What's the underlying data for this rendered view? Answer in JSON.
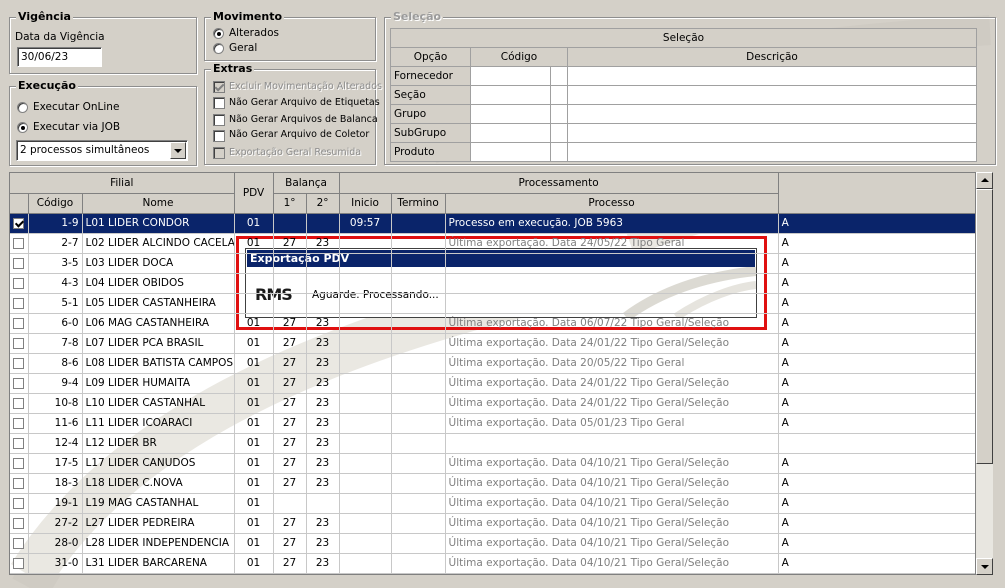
{
  "vigencia": {
    "title": "Vigência",
    "date_label": "Data da Vigência",
    "date_value": "30/06/23"
  },
  "movimento": {
    "title": "Movimento",
    "options": [
      "Alterados",
      "Geral"
    ],
    "selected": "Alterados"
  },
  "execucao": {
    "title": "Execução",
    "options": [
      "Executar OnLine",
      "Executar via JOB"
    ],
    "selected": "Executar via JOB",
    "combo_value": "2 processos simultâneos"
  },
  "extras": {
    "title": "Extras",
    "items": [
      {
        "label": "Excluir Movimentação Alterados",
        "checked": true,
        "disabled": true
      },
      {
        "label": "Não Gerar Arquivo de Etiquetas",
        "checked": false,
        "disabled": false
      },
      {
        "label": "Não Gerar Arquivos de Balanca",
        "checked": false,
        "disabled": false
      },
      {
        "label": "Não Gerar Arquivo de Coletor",
        "checked": false,
        "disabled": false
      },
      {
        "label": "Exportação Geral Resumida",
        "checked": false,
        "disabled": true
      }
    ]
  },
  "selecao": {
    "title": "Seleção",
    "header": "Seleção",
    "columns": [
      "Opção",
      "Código",
      "Descrição"
    ],
    "rows": [
      "Fornecedor",
      "Seção",
      "Grupo",
      "SubGrupo",
      "Produto"
    ]
  },
  "grid": {
    "groups": {
      "filial": "Filial",
      "pdv": "PDV",
      "balanca": "Balança",
      "processamento": "Processamento"
    },
    "columns": {
      "codigo": "Código",
      "nome": "Nome",
      "b1": "1°",
      "b2": "2°",
      "inicio": "Inicio",
      "termino": "Termino",
      "processo": "Processo"
    },
    "rows": [
      {
        "checked": true,
        "codigo": "1-9",
        "nome": "L01 LIDER CONDOR",
        "pdv": "01",
        "b1": "",
        "b2": "",
        "inicio": "09:57",
        "termino": "",
        "processo": "Processo em execução. JOB 5963",
        "extra": "A",
        "selected": true
      },
      {
        "checked": false,
        "codigo": "2-7",
        "nome": "L02 LIDER ALCINDO CACELA",
        "pdv": "01",
        "b1": "27",
        "b2": "23",
        "inicio": "",
        "termino": "",
        "processo": "Última exportação. Data 24/05/22 Tipo Geral",
        "extra": "A"
      },
      {
        "checked": false,
        "codigo": "3-5",
        "nome": "L03 LIDER DOCA",
        "pdv": "",
        "b1": "",
        "b2": "",
        "inicio": "",
        "termino": "",
        "processo": "",
        "extra": "A"
      },
      {
        "checked": false,
        "codigo": "4-3",
        "nome": "L04 LIDER OBIDOS",
        "pdv": "",
        "b1": "",
        "b2": "",
        "inicio": "",
        "termino": "",
        "processo": "",
        "extra": "A"
      },
      {
        "checked": false,
        "codigo": "5-1",
        "nome": "L05 LIDER CASTANHEIRA",
        "pdv": "",
        "b1": "",
        "b2": "",
        "inicio": "",
        "termino": "",
        "processo": "",
        "extra": "A"
      },
      {
        "checked": false,
        "codigo": "6-0",
        "nome": "L06 MAG CASTANHEIRA",
        "pdv": "01",
        "b1": "27",
        "b2": "23",
        "inicio": "",
        "termino": "",
        "processo": "Última exportação. Data 06/07/22 Tipo Geral/Seleção",
        "extra": "A"
      },
      {
        "checked": false,
        "codigo": "7-8",
        "nome": "L07 LIDER PCA BRASIL",
        "pdv": "01",
        "b1": "27",
        "b2": "23",
        "inicio": "",
        "termino": "",
        "processo": "Última exportação. Data 24/01/22 Tipo Geral/Seleção",
        "extra": "A"
      },
      {
        "checked": false,
        "codigo": "8-6",
        "nome": "L08 LIDER BATISTA CAMPOS",
        "pdv": "01",
        "b1": "27",
        "b2": "23",
        "inicio": "",
        "termino": "",
        "processo": "Última exportação. Data 20/05/22 Tipo Geral",
        "extra": "A"
      },
      {
        "checked": false,
        "codigo": "9-4",
        "nome": "L09 LIDER HUMAITA",
        "pdv": "01",
        "b1": "27",
        "b2": "23",
        "inicio": "",
        "termino": "",
        "processo": "Última exportação. Data 24/01/22 Tipo Geral/Seleção",
        "extra": "A"
      },
      {
        "checked": false,
        "codigo": "10-8",
        "nome": "L10 LIDER CASTANHAL",
        "pdv": "01",
        "b1": "27",
        "b2": "23",
        "inicio": "",
        "termino": "",
        "processo": "Última exportação. Data 24/01/22 Tipo Geral/Seleção",
        "extra": "A"
      },
      {
        "checked": false,
        "codigo": "11-6",
        "nome": "L11 LIDER ICOARACI",
        "pdv": "01",
        "b1": "27",
        "b2": "23",
        "inicio": "",
        "termino": "",
        "processo": "Última exportação. Data 05/01/23 Tipo Geral",
        "extra": "A"
      },
      {
        "checked": false,
        "codigo": "12-4",
        "nome": "L12 LIDER BR",
        "pdv": "01",
        "b1": "27",
        "b2": "23",
        "inicio": "",
        "termino": "",
        "processo": "",
        "extra": ""
      },
      {
        "checked": false,
        "codigo": "17-5",
        "nome": "L17 LIDER CANUDOS",
        "pdv": "01",
        "b1": "27",
        "b2": "23",
        "inicio": "",
        "termino": "",
        "processo": "Última exportação. Data 04/10/21 Tipo Geral/Seleção",
        "extra": "A"
      },
      {
        "checked": false,
        "codigo": "18-3",
        "nome": "L18 LIDER C.NOVA",
        "pdv": "01",
        "b1": "27",
        "b2": "23",
        "inicio": "",
        "termino": "",
        "processo": "Última exportação. Data 04/10/21 Tipo Geral/Seleção",
        "extra": "A"
      },
      {
        "checked": false,
        "codigo": "19-1",
        "nome": "L19 MAG CASTANHAL",
        "pdv": "01",
        "b1": "",
        "b2": "",
        "inicio": "",
        "termino": "",
        "processo": "Última exportação. Data 04/10/21 Tipo Geral/Seleção",
        "extra": "A"
      },
      {
        "checked": false,
        "codigo": "27-2",
        "nome": "L27 LIDER PEDREIRA",
        "pdv": "01",
        "b1": "27",
        "b2": "23",
        "inicio": "",
        "termino": "",
        "processo": "Última exportação. Data 04/10/21 Tipo Geral/Seleção",
        "extra": "A"
      },
      {
        "checked": false,
        "codigo": "28-0",
        "nome": "L28 LIDER INDEPENDENCIA",
        "pdv": "01",
        "b1": "27",
        "b2": "23",
        "inicio": "",
        "termino": "",
        "processo": "Última exportação. Data 04/10/21 Tipo Geral/Seleção",
        "extra": "A"
      },
      {
        "checked": false,
        "codigo": "31-0",
        "nome": "L31 LIDER BARCARENA",
        "pdv": "01",
        "b1": "27",
        "b2": "23",
        "inicio": "",
        "termino": "",
        "processo": "Última exportação. Data 04/10/21 Tipo Geral/Seleção",
        "extra": "A"
      }
    ]
  },
  "dialog": {
    "title": "Exportação PDV",
    "logo": "RMS",
    "message": "Aguarde. Processando..."
  },
  "colors": {
    "selection": "#0a246a",
    "highlight_border": "#e01010",
    "window_bg": "#d4d0c8"
  }
}
